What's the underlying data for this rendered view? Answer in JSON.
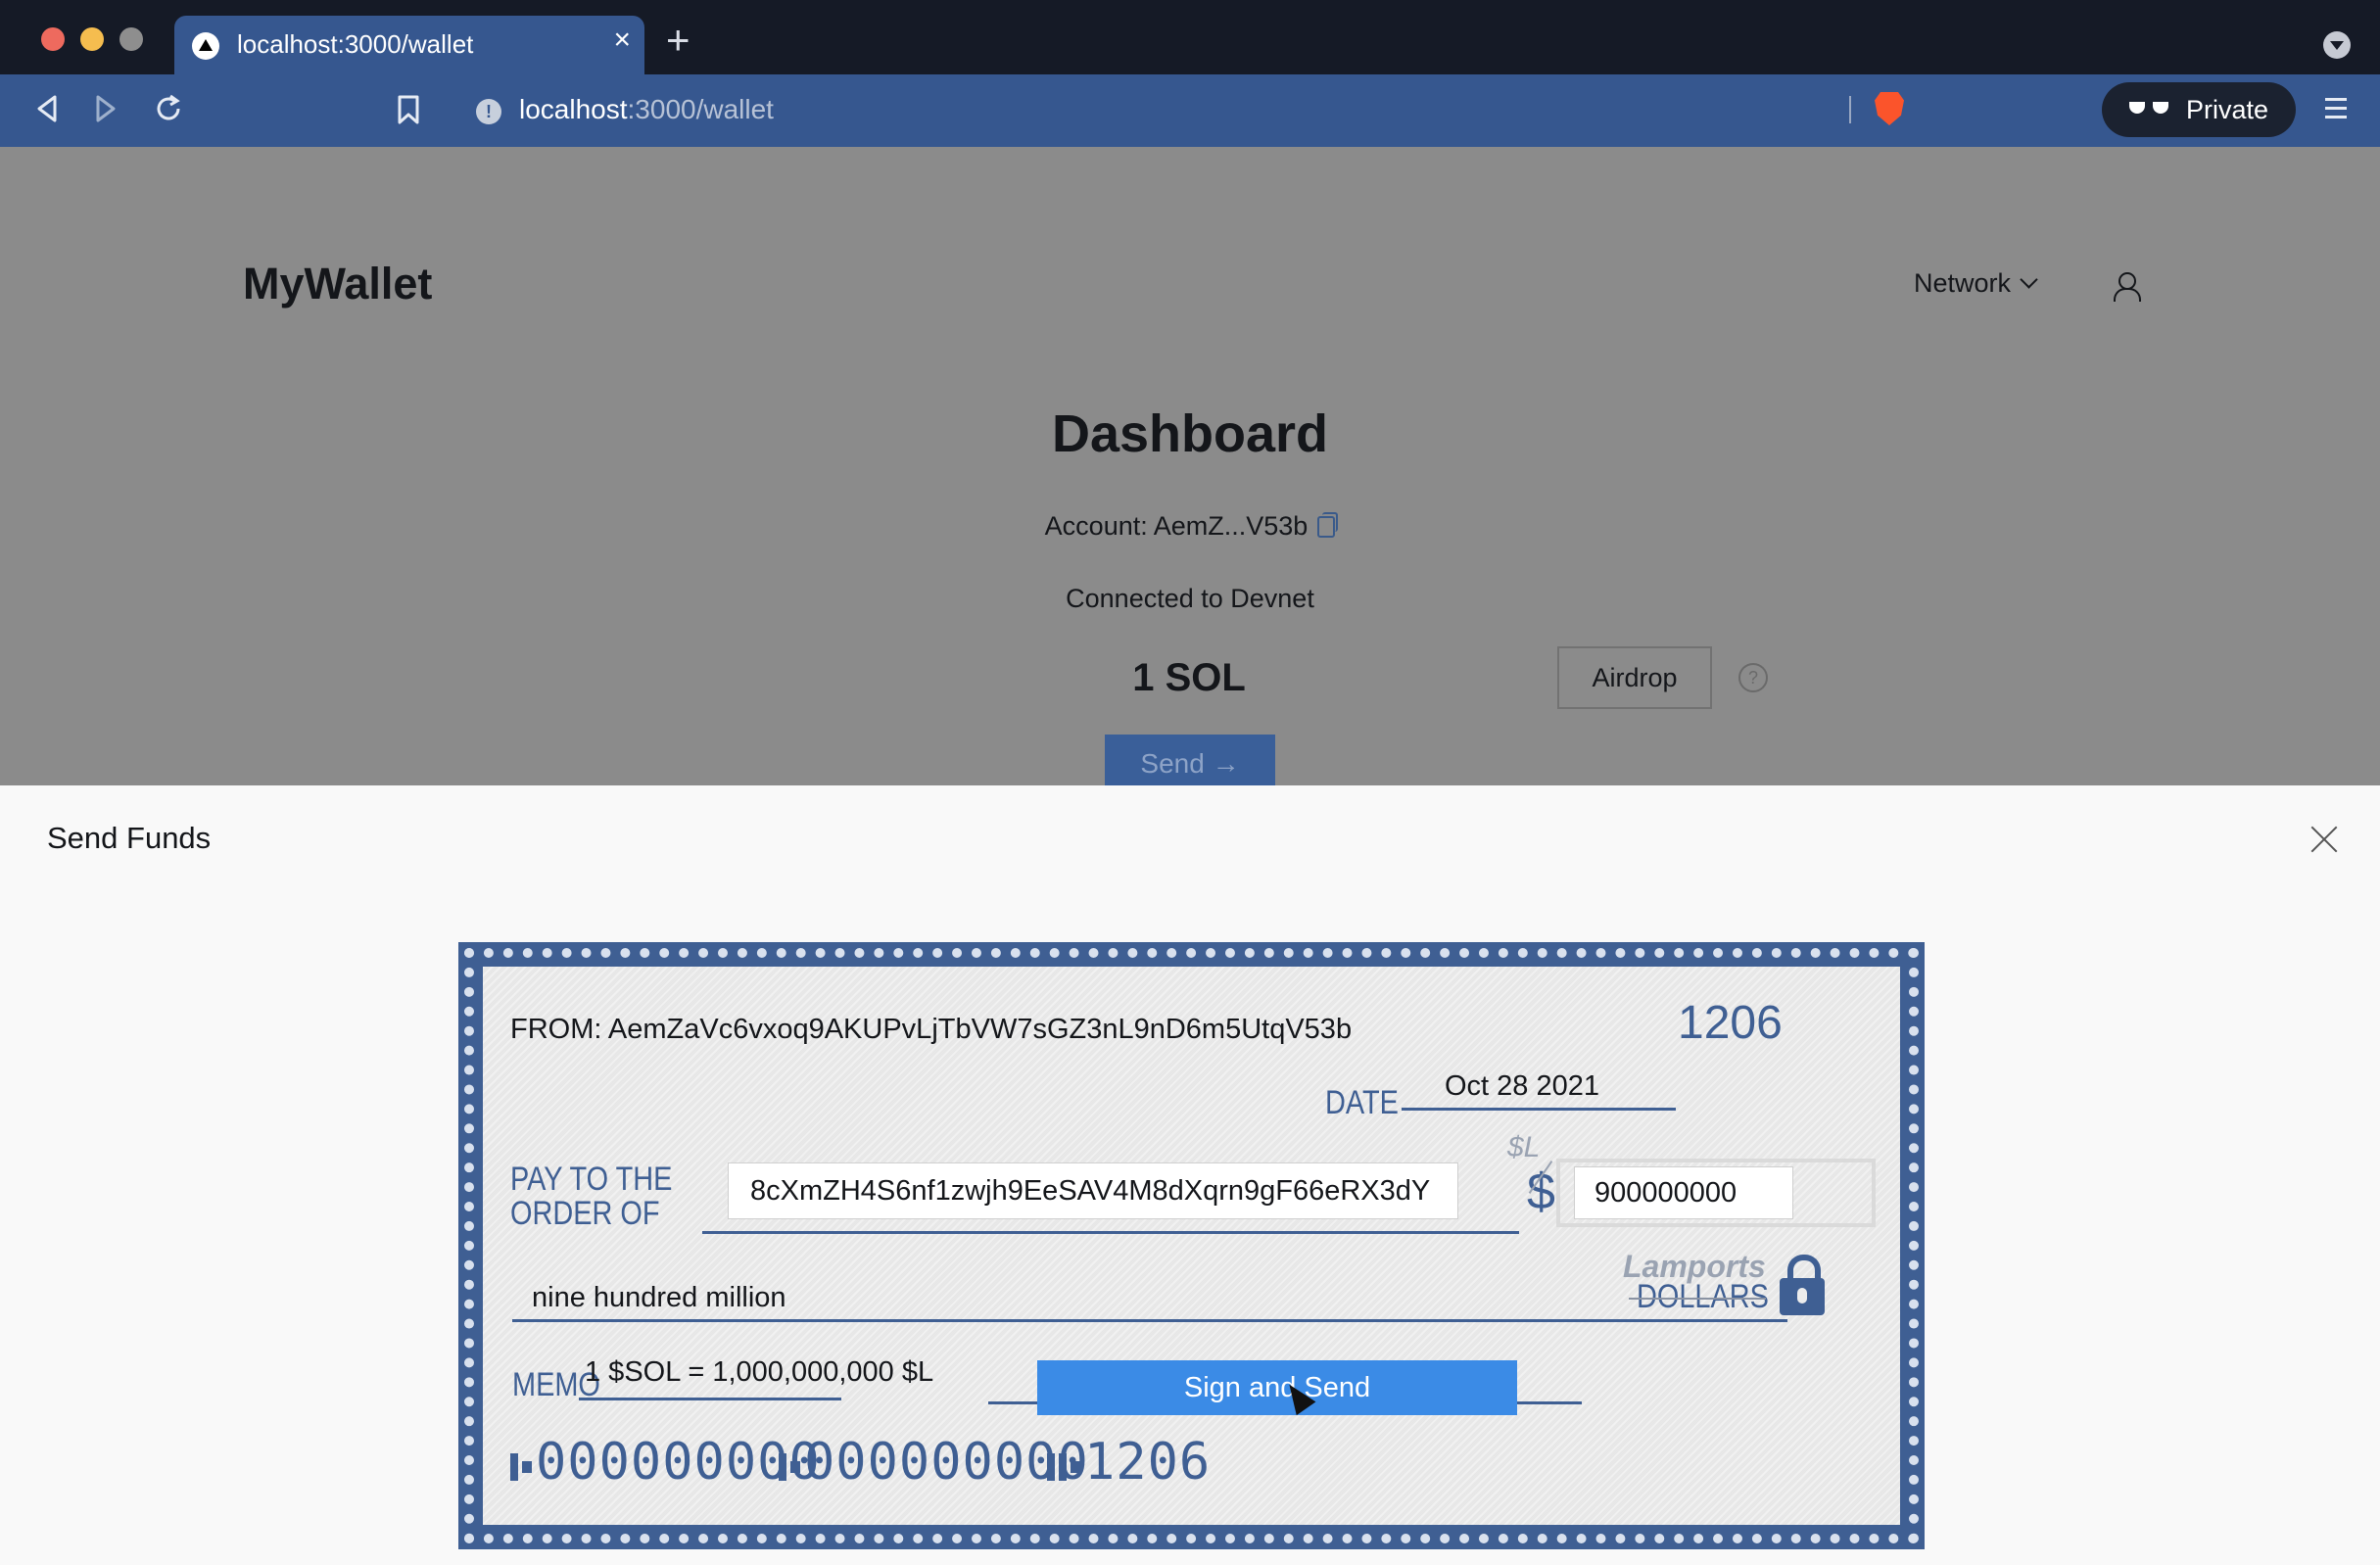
{
  "browser": {
    "tab_title": "localhost:3000/wallet",
    "tab_close": "×",
    "new_tab": "+",
    "url_host": "localhost",
    "url_rest": ":3000/wallet",
    "private_label": "Private"
  },
  "header": {
    "brand": "MyWallet",
    "network_label": "Network"
  },
  "dashboard": {
    "title": "Dashboard",
    "account_label": "Account: AemZ...V53b",
    "connected": "Connected to Devnet",
    "balance": "1 SOL",
    "airdrop_label": "Airdrop",
    "help": "?",
    "send_label": "Send →"
  },
  "drawer": {
    "title": "Send Funds"
  },
  "check": {
    "from": "FROM: AemZaVc6vxoq9AKUPvLjTbVW7sGZ3nL9nD6m5UtqV53b",
    "number": "1206",
    "date_label": "DATE",
    "date": "Oct 28 2021",
    "pay_label_line1": "PAY TO THE",
    "pay_label_line2": "ORDER OF",
    "recipient": "8cXmZH4S6nf1zwjh9EeSAV4M8dXqrn9gF66eRX3dY",
    "sl_symbol": "$L",
    "dollar_symbol": "$",
    "amount": "900000000",
    "lamports_label": "Lamports",
    "dollars_label": "DOLLARS",
    "amount_words": "nine hundred million",
    "memo_label": "MEMO",
    "memo": "1 $SOL = 1,000,000,000 $L",
    "sign_button": "Sign and Send",
    "micr_routing": "000000000",
    "micr_account": "000000000",
    "micr_check": "1206"
  }
}
